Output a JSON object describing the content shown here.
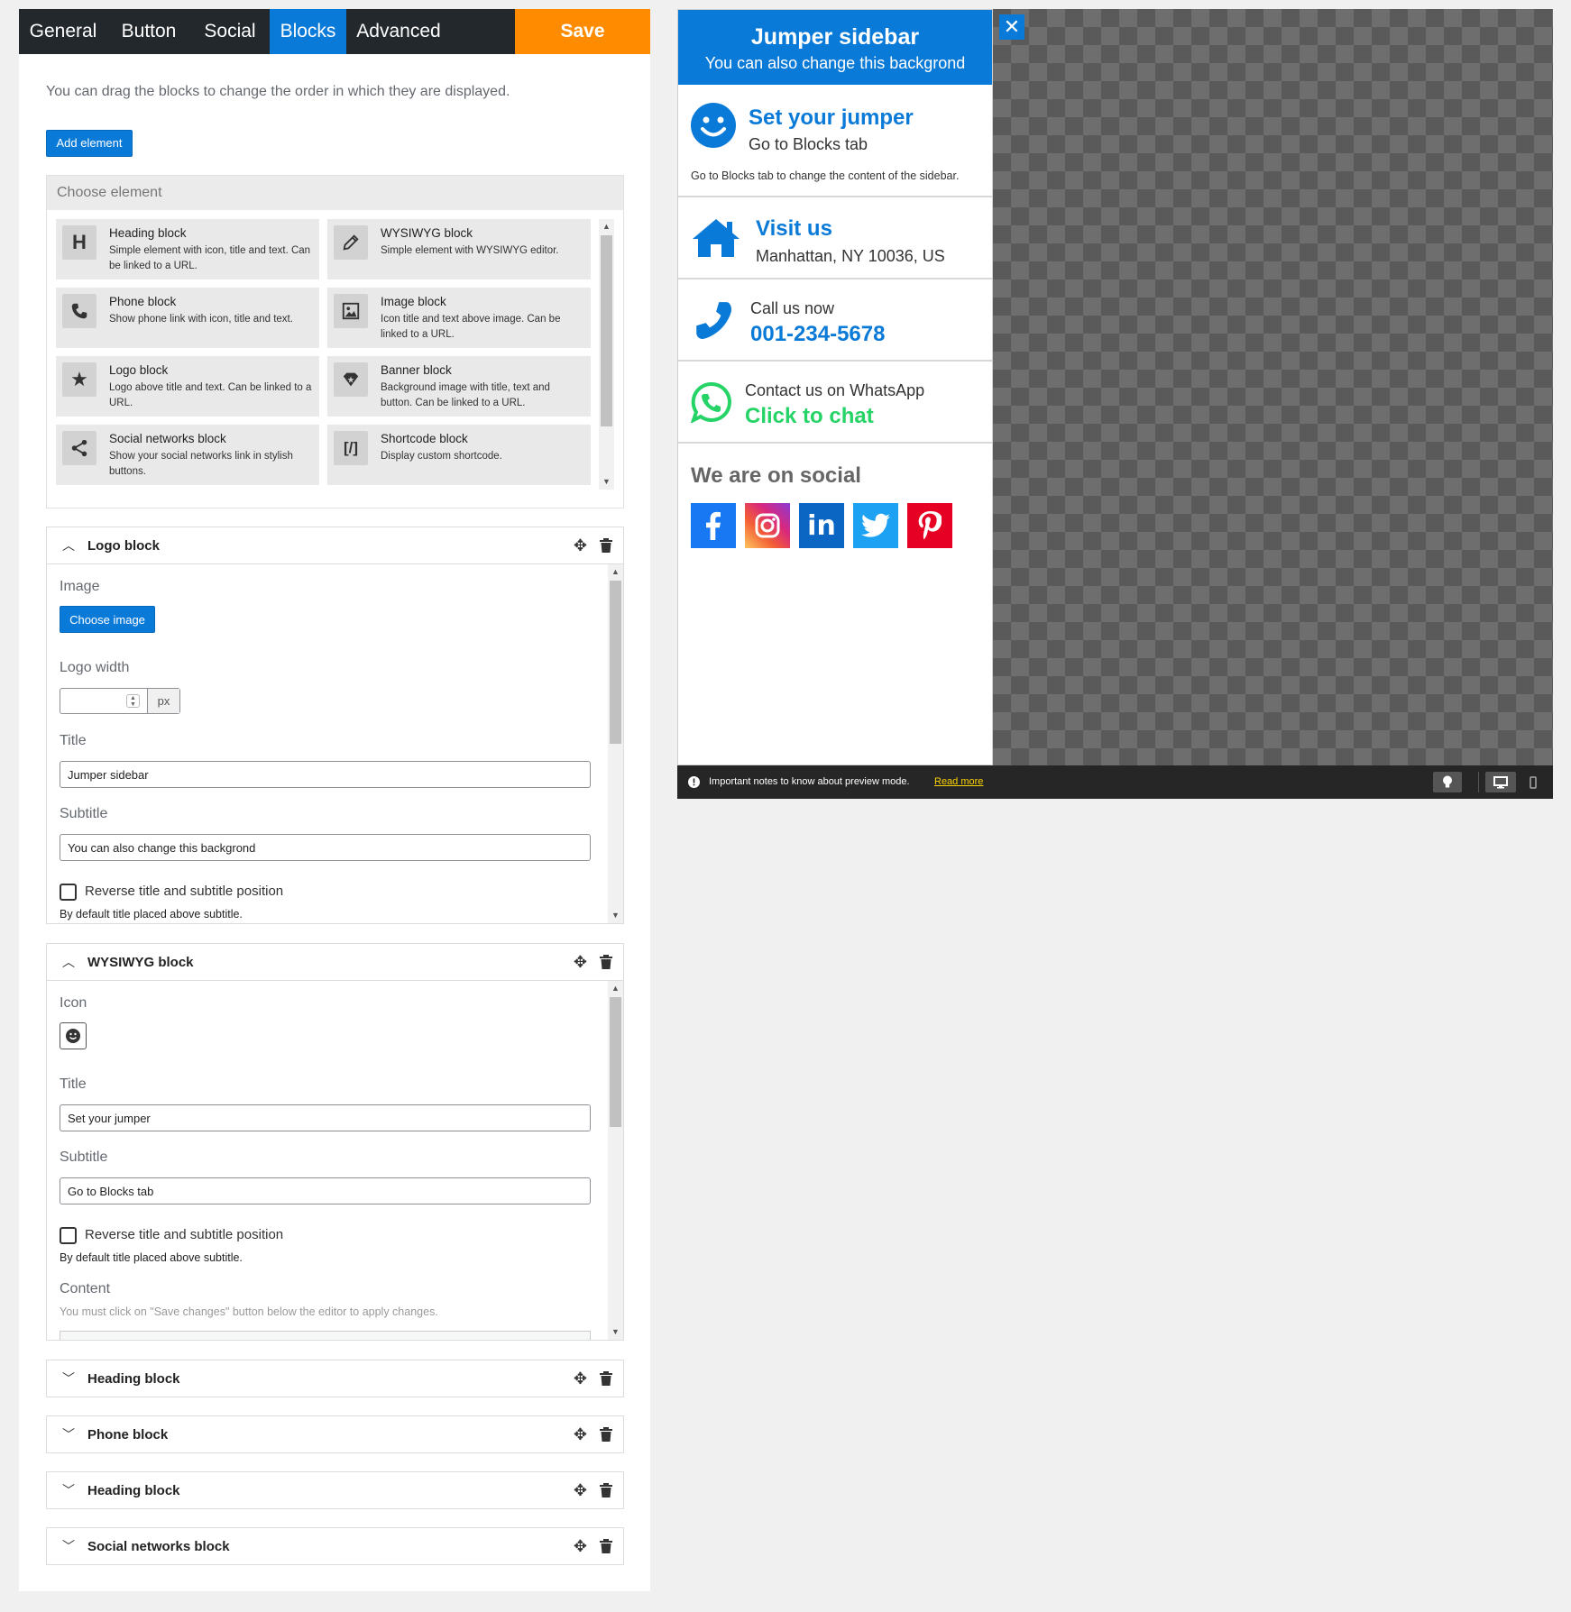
{
  "tabs": [
    {
      "label": "General"
    },
    {
      "label": "Button"
    },
    {
      "label": "Social"
    },
    {
      "label": "Blocks"
    },
    {
      "label": "Advanced"
    }
  ],
  "active_tab": "Blocks",
  "save_label": "Save",
  "intro_text": "You can drag the blocks to change the order in which they are displayed.",
  "add_element_label": "Add element",
  "chooser": {
    "heading": "Choose element",
    "elements": [
      {
        "title": "Heading block",
        "desc": "Simple element with icon, title and text. Can be linked to a URL.",
        "icon": "heading-icon"
      },
      {
        "title": "WYSIWYG block",
        "desc": "Simple element with WYSIWYG editor.",
        "icon": "pencil-icon"
      },
      {
        "title": "Phone block",
        "desc": "Show phone link with icon, title and text.",
        "icon": "phone-icon"
      },
      {
        "title": "Image block",
        "desc": "Icon title and text above image. Can be linked to a URL.",
        "icon": "image-icon"
      },
      {
        "title": "Logo block",
        "desc": "Logo above title and text. Can be linked to a URL.",
        "icon": "star-icon"
      },
      {
        "title": "Banner block",
        "desc": "Background image with title, text and button. Can be linked to a URL.",
        "icon": "banner-icon"
      },
      {
        "title": "Social networks block",
        "desc": "Show your social networks link in stylish buttons.",
        "icon": "share-icon"
      },
      {
        "title": "Shortcode block",
        "desc": "Display custom shortcode.",
        "icon": "shortcode-icon"
      }
    ]
  },
  "logo_block": {
    "title": "Logo block",
    "image_label": "Image",
    "choose_image_label": "Choose image",
    "logo_width_label": "Logo width",
    "logo_width_value": "",
    "unit": "px",
    "title_label": "Title",
    "title_value": "Jumper sidebar",
    "subtitle_label": "Subtitle",
    "subtitle_value": "You can also change this backgrond",
    "reverse_label": "Reverse title and subtitle position",
    "reverse_note": "By default title placed above subtitle."
  },
  "wysiwyg_block": {
    "title": "WYSIWYG block",
    "icon_label": "Icon",
    "title_label": "Title",
    "title_value": "Set your jumper",
    "subtitle_label": "Subtitle",
    "subtitle_value": "Go to Blocks tab",
    "reverse_label": "Reverse title and subtitle position",
    "reverse_note": "By default title placed above subtitle.",
    "content_label": "Content",
    "content_note": "You must click on \"Save changes\" button below the editor to apply changes."
  },
  "collapsed_blocks": [
    {
      "title": "Heading block"
    },
    {
      "title": "Phone block"
    },
    {
      "title": "Heading block"
    },
    {
      "title": "Social networks block"
    }
  ],
  "preview": {
    "header_title": "Jumper sidebar",
    "header_subtitle": "You can also change this backgrond",
    "close_label": "✕",
    "jumper_title": "Set your jumper",
    "jumper_subtitle": "Go to Blocks tab",
    "jumper_text": "Go to Blocks tab to change the content of the sidebar.",
    "visit_title": "Visit us",
    "visit_address": "Manhattan, NY 10036, US",
    "call_label": "Call us now",
    "call_number": "001-234-5678",
    "whatsapp_label": "Contact us on WhatsApp",
    "whatsapp_cta": "Click to chat",
    "social_heading": "We are on social",
    "social_networks": [
      "facebook",
      "instagram",
      "linkedin",
      "twitter",
      "pinterest"
    ],
    "notes_text": "Important notes to know about preview mode.",
    "read_more": "Read more"
  },
  "colors": {
    "accent": "#0a7ad8",
    "save": "#ff8c00",
    "whatsapp": "#25d366",
    "facebook": "#1877f2",
    "linkedin": "#0a66c2",
    "twitter": "#1da1f2",
    "pinterest": "#e60023"
  }
}
